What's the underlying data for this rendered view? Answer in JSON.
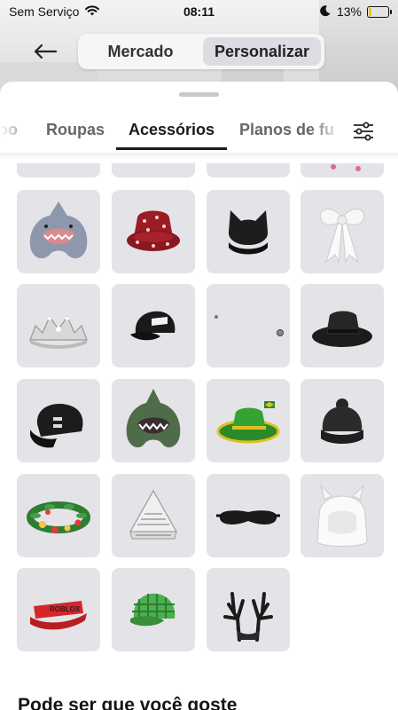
{
  "status": {
    "carrier": "Sem Serviço",
    "time": "08:11",
    "battery_percent": "13%",
    "battery_level": 0.13
  },
  "header": {
    "segments": [
      {
        "label": "Mercado",
        "active": false
      },
      {
        "label": "Personalizar",
        "active": true
      }
    ]
  },
  "tabs": {
    "items": [
      {
        "label": "po",
        "active": false
      },
      {
        "label": "Roupas",
        "active": false
      },
      {
        "label": "Acessórios",
        "active": true
      },
      {
        "label": "Planos de fu",
        "active": false
      }
    ]
  },
  "items": [
    {
      "name": "partial-item-1"
    },
    {
      "name": "partial-item-2"
    },
    {
      "name": "partial-item-3"
    },
    {
      "name": "partial-item-4"
    },
    {
      "name": "shark-hood"
    },
    {
      "name": "red-bucket-hat"
    },
    {
      "name": "black-cat-ear-beanie"
    },
    {
      "name": "white-bow"
    },
    {
      "name": "silver-tiara"
    },
    {
      "name": "black-cap"
    },
    {
      "name": "small-earrings"
    },
    {
      "name": "black-fedora"
    },
    {
      "name": "black-backwards-cap"
    },
    {
      "name": "green-shark-hood"
    },
    {
      "name": "green-brazil-hat"
    },
    {
      "name": "black-beanie"
    },
    {
      "name": "flower-crown"
    },
    {
      "name": "newspaper-hat"
    },
    {
      "name": "sleep-mask"
    },
    {
      "name": "white-horn-hood"
    },
    {
      "name": "red-visor"
    },
    {
      "name": "green-plaid-cap"
    },
    {
      "name": "dark-antlers"
    }
  ],
  "visor_text": "ROBLOX",
  "section": {
    "title": "Pode ser que você goste"
  },
  "colors": {
    "tile_bg": "#e4e4e8",
    "active_tab": "#1b1b1f",
    "inactive_tab": "#66676d",
    "battery_fill": "#f0c400"
  }
}
